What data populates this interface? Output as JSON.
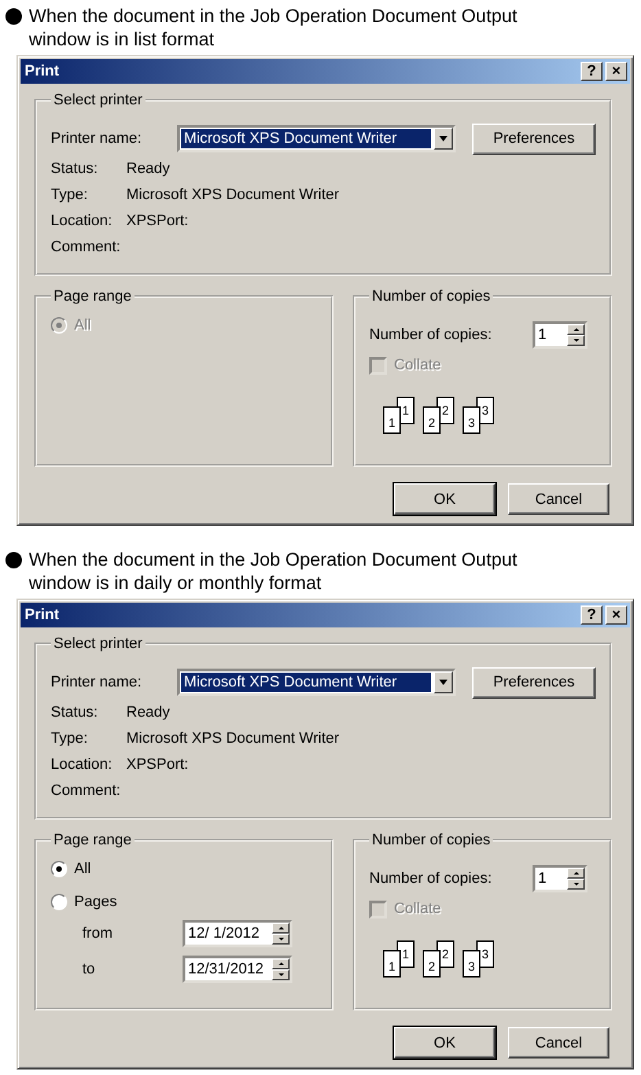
{
  "sections": [
    {
      "caption": "When the document in the Job Operation Document Output window is in list format",
      "dialog": {
        "title": "Print",
        "title_buttons": [
          "?",
          "×"
        ],
        "select_printer": {
          "legend": "Select printer",
          "printer_label": "Printer name:",
          "printer_value": "Microsoft XPS Document Writer",
          "preferences_button": "Preferences",
          "info": [
            {
              "label": "Status:",
              "value": "Ready"
            },
            {
              "label": "Type:",
              "value": "Microsoft XPS Document Writer"
            },
            {
              "label": "Location:",
              "value": "XPSPort:"
            },
            {
              "label": "Comment:"
            }
          ]
        },
        "page_range": {
          "legend": "Page range",
          "options": [
            {
              "label": "All",
              "selected": true,
              "disabled": true
            }
          ]
        },
        "copies": {
          "legend": "Number of copies",
          "label": "Number of copies:",
          "value": "1",
          "collate": {
            "label": "Collate",
            "checked": false,
            "disabled": true
          },
          "collate_pages": [
            {
              "front": "1",
              "back": "1"
            },
            {
              "front": "2",
              "back": "2"
            },
            {
              "front": "3",
              "back": "3"
            }
          ]
        },
        "buttons": [
          {
            "label": "OK",
            "default": true
          },
          {
            "label": "Cancel",
            "default": false
          }
        ]
      }
    },
    {
      "caption": "When the document in the Job Operation Document Output window is in daily or monthly format",
      "dialog": {
        "title": "Print",
        "title_buttons": [
          "?",
          "×"
        ],
        "select_printer": {
          "legend": "Select printer",
          "printer_label": "Printer name:",
          "printer_value": "Microsoft XPS Document Writer",
          "preferences_button": "Preferences",
          "info": [
            {
              "label": "Status:",
              "value": "Ready"
            },
            {
              "label": "Type:",
              "value": "Microsoft XPS Document Writer"
            },
            {
              "label": "Location:",
              "value": "XPSPort:"
            },
            {
              "label": "Comment:"
            }
          ]
        },
        "page_range": {
          "legend": "Page range",
          "options": [
            {
              "label": "All",
              "selected": true,
              "disabled": false
            },
            {
              "label": "Pages",
              "selected": false,
              "disabled": false
            }
          ],
          "range_fields": [
            {
              "label": "from",
              "value": "12/ 1/2012"
            },
            {
              "label": "to",
              "value": "12/31/2012"
            }
          ]
        },
        "copies": {
          "legend": "Number of copies",
          "label": "Number of copies:",
          "value": "1",
          "collate": {
            "label": "Collate",
            "checked": false,
            "disabled": true
          },
          "collate_pages": [
            {
              "front": "1",
              "back": "1"
            },
            {
              "front": "2",
              "back": "2"
            },
            {
              "front": "3",
              "back": "3"
            }
          ]
        },
        "buttons": [
          {
            "label": "OK",
            "default": true
          },
          {
            "label": "Cancel",
            "default": false
          }
        ]
      }
    }
  ]
}
